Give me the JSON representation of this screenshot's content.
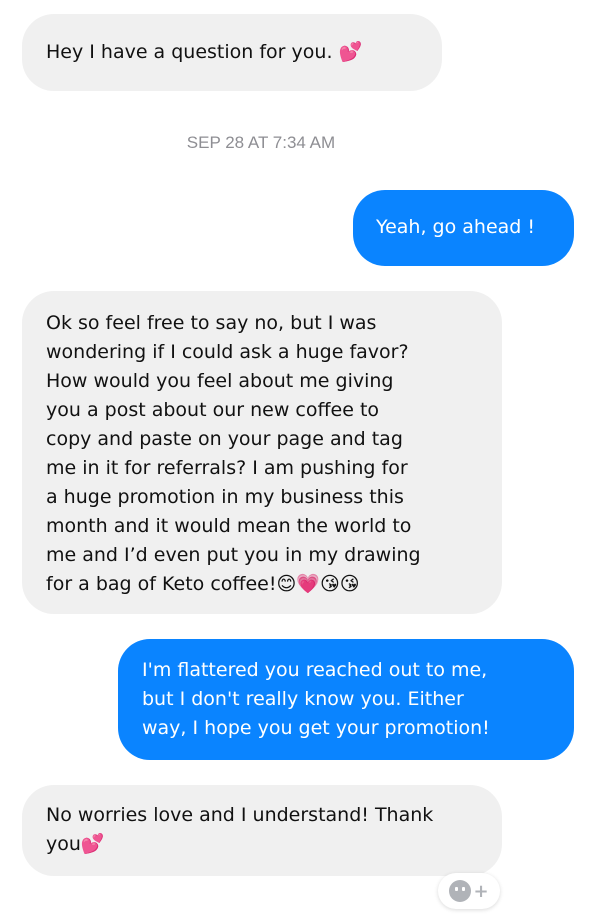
{
  "conversation": {
    "messages": [
      {
        "sender": "other",
        "text": "Hey  I have a question for you. 💕"
      },
      {
        "sender": "me",
        "text": "Yeah, go ahead !"
      },
      {
        "sender": "other",
        "text": "Ok so feel free to say no, but I was\nwondering if I could ask a huge favor?\nHow would you feel about me giving\nyou a post about our new coffee to\ncopy and paste on your page and tag\nme in it for referrals? I am pushing for\na huge promotion in my business this\nmonth and it would mean the world to\nme and I’d even put you in my drawing\nfor a bag of Keto coffee!😊💗😘😘"
      },
      {
        "sender": "me",
        "text": "I'm flattered you reached out to me,\nbut I don't really know you. Either\nway, I hope you get your promotion!"
      },
      {
        "sender": "other",
        "text": "No worries love and I understand! Thank\nyou💕"
      }
    ],
    "timestamp": "SEP 28 AT 7:34 AM"
  },
  "reaction_button": {
    "icon": "smiley-plus-icon",
    "color": "#b0b3b8"
  },
  "colors": {
    "outgoing_bubble": "#0a84ff",
    "incoming_bubble": "#f0f0f0",
    "timestamp": "#8e8e93"
  }
}
